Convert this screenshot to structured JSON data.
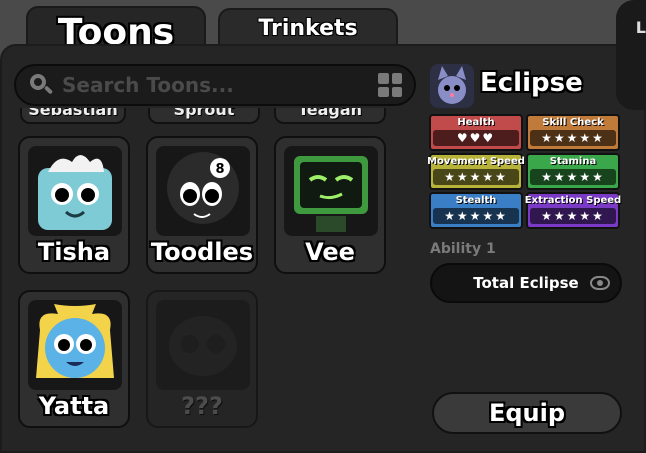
{
  "tabs": {
    "toons": "Toons",
    "trinkets": "Trinkets"
  },
  "search": {
    "placeholder": "Search Toons..."
  },
  "corner_char": "L",
  "partial_row": [
    "Sebastian",
    "Sprout",
    "Teagan"
  ],
  "toons": [
    {
      "name": "Tisha",
      "color": "#7ecbd6"
    },
    {
      "name": "Toodles",
      "color": "#2b2b2b"
    },
    {
      "name": "Vee",
      "color": "#3f9a3f"
    },
    {
      "name": "Yatta",
      "color": "#5ab2e6"
    },
    {
      "name": "???",
      "color": "#2a2a2a"
    }
  ],
  "selected": {
    "name": "Eclipse",
    "stats": [
      {
        "label": "Health",
        "value": "♥♥♥",
        "color": "#c14a4a"
      },
      {
        "label": "Skill Check",
        "value": "★★★★★",
        "color": "#c07a3a"
      },
      {
        "label": "Movement Speed",
        "value": "★★★★★",
        "color": "#b7b23a"
      },
      {
        "label": "Stamina",
        "value": "★★★★★",
        "color": "#3aa84a"
      },
      {
        "label": "Stealth",
        "value": "★★★★★",
        "color": "#3a7fc6"
      },
      {
        "label": "Extraction Speed",
        "value": "★★★★★",
        "color": "#7a3ac6"
      }
    ],
    "ability_label": "Ability 1",
    "ability_name": "Total Eclipse"
  },
  "equip_label": "Equip"
}
